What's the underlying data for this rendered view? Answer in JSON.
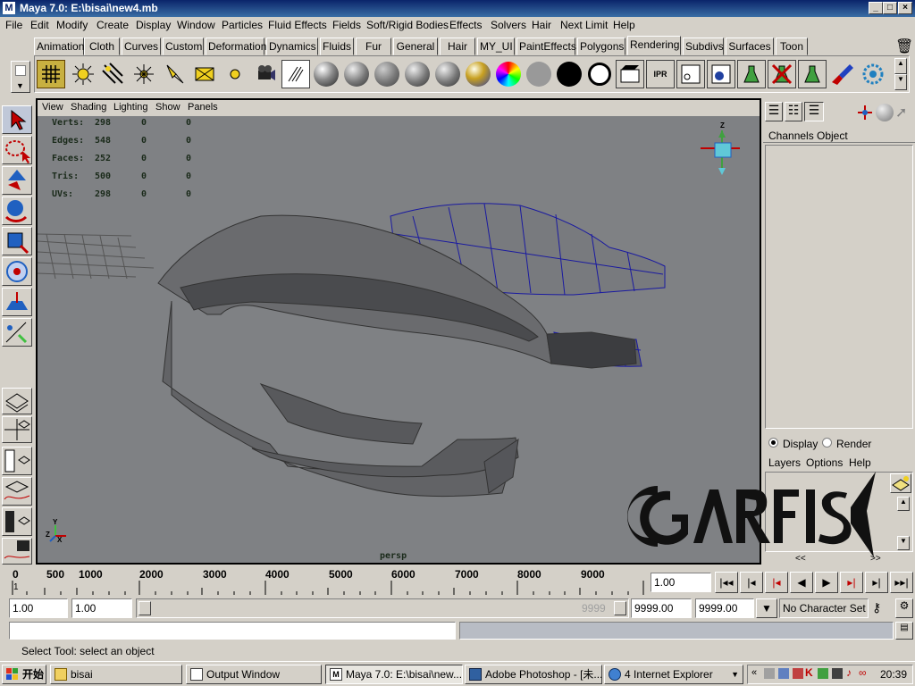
{
  "window": {
    "title": "Maya 7.0: E:\\bisai\\new4.mb"
  },
  "menu": [
    "File",
    "Edit",
    "Modify",
    "Create",
    "Display",
    "Window",
    "Particles",
    "Fluid Effects",
    "Fields",
    "Soft/Rigid Bodies",
    "Effects",
    "Solvers",
    "Hair",
    "Next Limit",
    "Help"
  ],
  "shelf_tabs": [
    "Animation",
    "Cloth",
    "Curves",
    "Custom",
    "Deformation",
    "Dynamics",
    "Fluids",
    "Fur",
    "General",
    "Hair",
    "MY_UI",
    "PaintEffects",
    "Polygons",
    "Rendering",
    "Subdivs",
    "Surfaces",
    "Toon"
  ],
  "active_shelf_tab": "Rendering",
  "viewport": {
    "menu": [
      "View",
      "Shading",
      "Lighting",
      "Show",
      "Panels"
    ],
    "hud": [
      {
        "label": "Verts:",
        "v1": "298",
        "v2": "0",
        "v3": "0"
      },
      {
        "label": "Edges:",
        "v1": "548",
        "v2": "0",
        "v3": "0"
      },
      {
        "label": "Faces:",
        "v1": "252",
        "v2": "0",
        "v3": "0"
      },
      {
        "label": "Tris:",
        "v1": "500",
        "v2": "0",
        "v3": "0"
      },
      {
        "label": "UVs:",
        "v1": "298",
        "v2": "0",
        "v3": "0"
      }
    ],
    "camera_label": "persp",
    "axis": {
      "x": "X",
      "y": "Y",
      "z": "Z"
    },
    "background": "#7f8184"
  },
  "channel_box": {
    "tabs": [
      "Channels",
      "Object"
    ]
  },
  "layer_editor": {
    "radio_display": "Display",
    "radio_render": "Render",
    "menu": [
      "Layers",
      "Options",
      "Help"
    ]
  },
  "watermark": "CGARFIST",
  "timeline": {
    "ticks": [
      "0",
      "500",
      "1000",
      "2000",
      "3000",
      "4000",
      "5000",
      "6000",
      "7000",
      "8000",
      "9000"
    ],
    "current_frame_marker": "1",
    "current_time": "1.00"
  },
  "range": {
    "start": "1.00",
    "playback_start": "1.00",
    "slider_end_label": "9999",
    "playback_end": "9999.00",
    "end": "9999.00",
    "character_set": "No Character Set"
  },
  "help_line": "Select Tool: select an object",
  "taskbar": {
    "start": "开始",
    "tasks": [
      "bisai",
      "Output Window",
      "Maya 7.0: E:\\bisai\\new...",
      "Adobe Photoshop - [未...",
      "4 Internet Explorer"
    ],
    "clock": "20:39"
  },
  "colors": {
    "title_bar": "#0a246a",
    "selection_wire": "#1a1aa0",
    "accent_red": "#c00000"
  }
}
